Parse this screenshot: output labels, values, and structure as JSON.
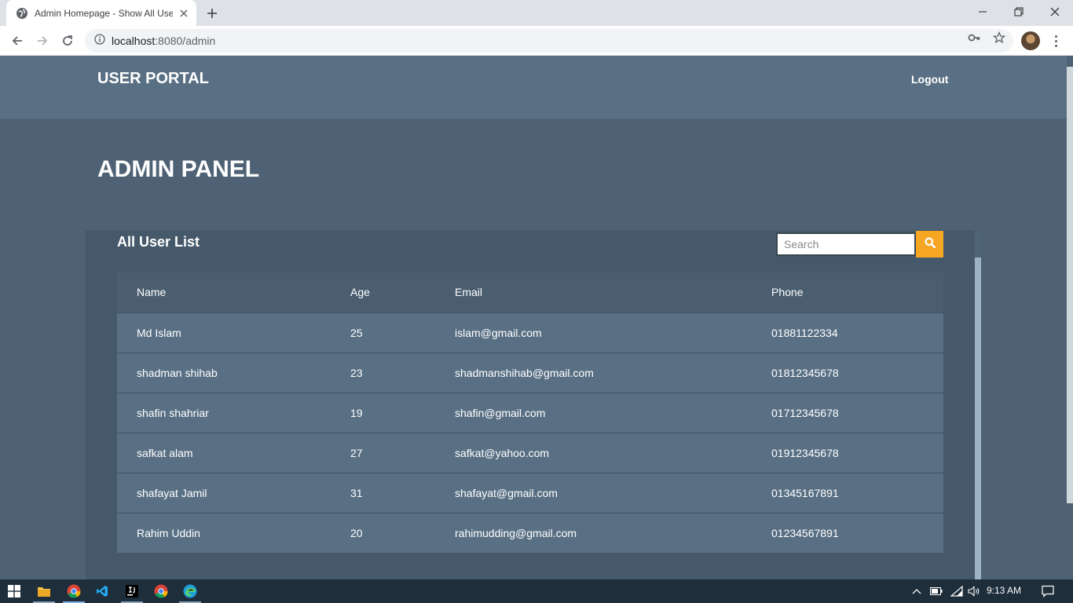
{
  "browser": {
    "tab_title": "Admin Homepage - Show All Users",
    "url_host": "localhost",
    "url_path": ":8080/admin"
  },
  "navbar": {
    "brand": "USER PORTAL",
    "logout": "Logout"
  },
  "main": {
    "title": "ADMIN PANEL"
  },
  "panel": {
    "title": "All User List",
    "search_placeholder": "Search",
    "columns": [
      "Name",
      "Age",
      "Email",
      "Phone"
    ],
    "rows": [
      {
        "name": "Md Islam",
        "age": "25",
        "email": "islam@gmail.com",
        "phone": "01881122334"
      },
      {
        "name": "shadman shihab",
        "age": "23",
        "email": "shadmanshihab@gmail.com",
        "phone": "01812345678"
      },
      {
        "name": "shafin shahriar",
        "age": "19",
        "email": "shafin@gmail.com",
        "phone": "01712345678"
      },
      {
        "name": "safkat alam",
        "age": "27",
        "email": "safkat@yahoo.com",
        "phone": "01912345678"
      },
      {
        "name": "shafayat Jamil",
        "age": "31",
        "email": "shafayat@gmail.com",
        "phone": "01345167891"
      },
      {
        "name": "Rahim Uddin",
        "age": "20",
        "email": "rahimudding@gmail.com",
        "phone": "01234567891"
      }
    ]
  },
  "taskbar": {
    "clock": "9:13 AM"
  },
  "colors": {
    "accent": "#f5a623",
    "navbar": "#597084",
    "page_bg": "#4f6275",
    "panel_bg": "#45596b"
  }
}
